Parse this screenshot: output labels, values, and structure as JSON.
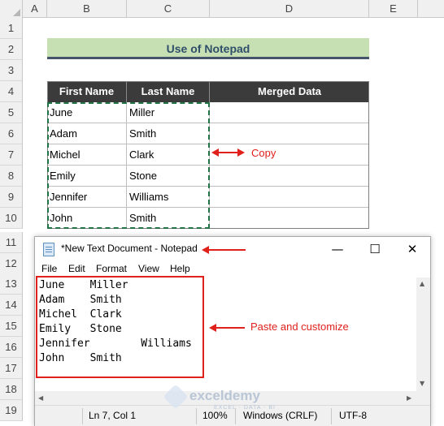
{
  "columns": [
    "A",
    "B",
    "C",
    "D",
    "E"
  ],
  "rows": [
    "1",
    "2",
    "3",
    "4",
    "5",
    "6",
    "7",
    "8",
    "9",
    "10",
    "11",
    "12",
    "13",
    "14",
    "15",
    "16",
    "17",
    "18",
    "19"
  ],
  "sheet": {
    "title": "Use of Notepad",
    "headers": [
      "First Name",
      "Last Name",
      "Merged Data"
    ],
    "data": [
      [
        "June",
        "Miller"
      ],
      [
        "Adam",
        "Smith"
      ],
      [
        "Michel",
        "Clark"
      ],
      [
        "Emily",
        "Stone"
      ],
      [
        "Jennifer",
        "Williams"
      ],
      [
        "John",
        "Smith"
      ]
    ]
  },
  "annotations": {
    "copy_label": "Copy",
    "paste_label": "Paste and customize",
    "color": "#e0201b"
  },
  "notepad": {
    "title": "*New Text Document - Notepad",
    "icon": "notepad-icon",
    "controls": {
      "minimize": "—",
      "maximize": "☐",
      "close": "✕"
    },
    "menu": [
      "File",
      "Edit",
      "Format",
      "View",
      "Help"
    ],
    "lines": [
      "June    Miller",
      "Adam    Smith",
      "Michel  Clark",
      "Emily   Stone",
      "Jennifer        Williams",
      "John    Smith"
    ],
    "status": {
      "position": "Ln 7, Col 1",
      "zoom": "100%",
      "line_ending": "Windows (CRLF)",
      "encoding": "UTF-8"
    }
  },
  "watermark": {
    "name": "exceldemy",
    "tagline": "EXCEL · DATA · BI"
  },
  "colors": {
    "title_fill": "#c6e0b4",
    "header_fill": "#3b3b3b",
    "selection_dash": "#217346"
  }
}
